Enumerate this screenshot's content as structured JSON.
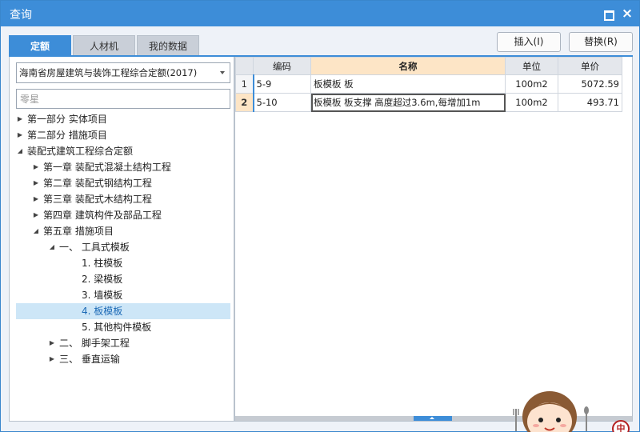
{
  "window": {
    "title": "查询"
  },
  "tabs": [
    {
      "label": "定额",
      "active": true
    },
    {
      "label": "人材机",
      "active": false
    },
    {
      "label": "我的数据",
      "active": false
    }
  ],
  "actions": {
    "insert": "插入(I)",
    "replace": "替换(R)"
  },
  "left": {
    "library_select": "海南省房屋建筑与装饰工程综合定额(2017)",
    "search_value": "",
    "search_placeholder": "零星",
    "tree": [
      {
        "label": "第一部分  实体项目",
        "level": 0,
        "arrow": "▶",
        "selected": false
      },
      {
        "label": "第二部分  措施项目",
        "level": 0,
        "arrow": "▶",
        "selected": false
      },
      {
        "label": "装配式建筑工程综合定额",
        "level": 0,
        "arrow": "◢",
        "selected": false
      },
      {
        "label": "第一章  装配式混凝土结构工程",
        "level": 1,
        "arrow": "▶",
        "selected": false
      },
      {
        "label": "第二章  装配式钢结构工程",
        "level": 1,
        "arrow": "▶",
        "selected": false
      },
      {
        "label": "第三章  装配式木结构工程",
        "level": 1,
        "arrow": "▶",
        "selected": false
      },
      {
        "label": "第四章  建筑构件及部品工程",
        "level": 1,
        "arrow": "▶",
        "selected": false
      },
      {
        "label": "第五章  措施项目",
        "level": 1,
        "arrow": "◢",
        "selected": false
      },
      {
        "label": "一、  工具式模板",
        "level": 2,
        "arrow": "◢",
        "selected": false
      },
      {
        "label": "1.  柱模板",
        "level": 3,
        "arrow": "",
        "selected": false
      },
      {
        "label": "2.  梁模板",
        "level": 3,
        "arrow": "",
        "selected": false
      },
      {
        "label": "3.  墙模板",
        "level": 3,
        "arrow": "",
        "selected": false
      },
      {
        "label": "4.  板模板",
        "level": 3,
        "arrow": "",
        "selected": true
      },
      {
        "label": "5.  其他构件模板",
        "level": 3,
        "arrow": "",
        "selected": false
      },
      {
        "label": "二、  脚手架工程",
        "level": 2,
        "arrow": "▶",
        "selected": false
      },
      {
        "label": "三、  垂直运输",
        "level": 2,
        "arrow": "▶",
        "selected": false
      }
    ]
  },
  "grid": {
    "headers": {
      "rownum": "",
      "code": "编码",
      "name": "名称",
      "unit": "单位",
      "price": "单价"
    },
    "rows": [
      {
        "rownum": "1",
        "code": "5-9",
        "name": "板模板  板",
        "unit": "100m2",
        "price": "5072.59",
        "active": false
      },
      {
        "rownum": "2",
        "code": "5-10",
        "name": "板模板  板支撑  高度超过3.6m,每增加1m",
        "unit": "100m2",
        "price": "493.71",
        "active": true
      }
    ]
  },
  "badge": {
    "text": "中"
  },
  "colors": {
    "accent": "#3d8dd8",
    "selected_bg": "#cde6f7",
    "header_highlight": "#fde5c6"
  }
}
